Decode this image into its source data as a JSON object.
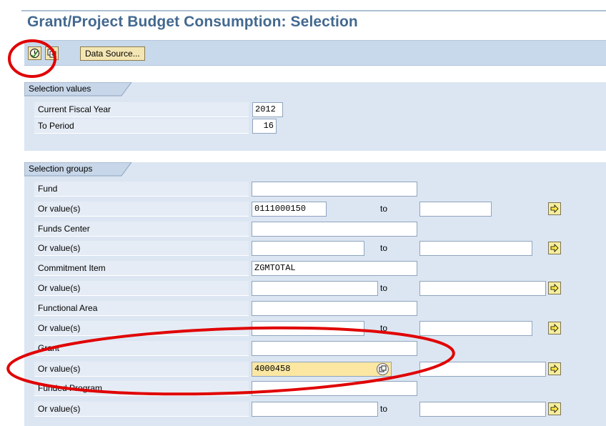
{
  "header": {
    "title": "Grant/Project Budget Consumption: Selection"
  },
  "toolbar": {
    "execute_icon": "execute-clock-icon",
    "copy_icon": "copy-icon",
    "data_source_label": "Data Source..."
  },
  "selection_values": {
    "title": "Selection values",
    "fields": [
      {
        "label": "Current Fiscal Year",
        "value": "2012"
      },
      {
        "label": "To Period",
        "value": "16"
      }
    ]
  },
  "selection_groups": {
    "title": "Selection groups",
    "to_label": "to",
    "rows": [
      {
        "label": "Fund",
        "value": ""
      },
      {
        "label": "Or value(s)",
        "from": "0111000150",
        "to": ""
      },
      {
        "label": "Funds Center",
        "value": ""
      },
      {
        "label": "Or value(s)",
        "from": "",
        "to": ""
      },
      {
        "label": "Commitment Item",
        "value": "ZGMTOTAL"
      },
      {
        "label": "Or value(s)",
        "from": "",
        "to": ""
      },
      {
        "label": "Functional Area",
        "value": ""
      },
      {
        "label": "Or value(s)",
        "from": "",
        "to": ""
      },
      {
        "label": "Grant",
        "value": ""
      },
      {
        "label": "Or value(s)",
        "from": "4000458",
        "to": ""
      },
      {
        "label": "Funded Program",
        "value": ""
      },
      {
        "label": "Or value(s)",
        "from": "",
        "to": ""
      }
    ]
  },
  "colors": {
    "title": "#43698f",
    "toolbar_bg": "#c9d9ec",
    "panel_bg": "#dce6f2",
    "highlight_field": "#fbe7a2",
    "annotation_red": "#e00000"
  }
}
